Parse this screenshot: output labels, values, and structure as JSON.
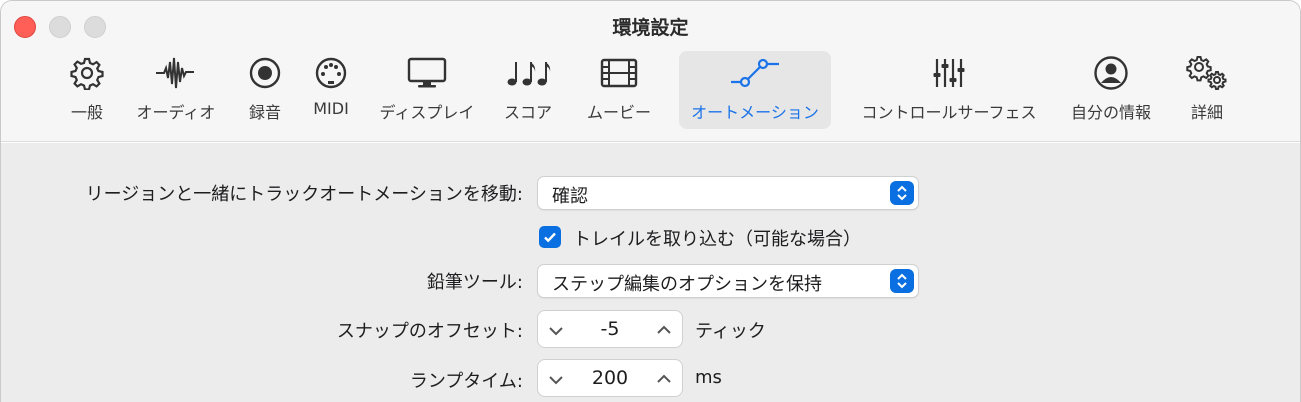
{
  "window": {
    "title": "環境設定"
  },
  "toolbar": {
    "tabs": [
      {
        "label": "一般",
        "icon": "gear-icon"
      },
      {
        "label": "オーディオ",
        "icon": "waveform-icon"
      },
      {
        "label": "録音",
        "icon": "record-icon"
      },
      {
        "label": "MIDI",
        "icon": "midi-connector-icon"
      },
      {
        "label": "ディスプレイ",
        "icon": "display-icon"
      },
      {
        "label": "スコア",
        "icon": "music-notes-icon"
      },
      {
        "label": "ムービー",
        "icon": "film-icon"
      },
      {
        "label": "オートメーション",
        "icon": "automation-curve-icon",
        "selected": true
      },
      {
        "label": "コントロールサーフェス",
        "icon": "faders-icon"
      },
      {
        "label": "自分の情報",
        "icon": "person-icon"
      },
      {
        "label": "詳細",
        "icon": "gears-icon"
      }
    ]
  },
  "settings": {
    "move_automation": {
      "label": "リージョンと一緒にトラックオートメーションを移動:",
      "value": "確認"
    },
    "include_trail": {
      "label": "トレイルを取り込む（可能な場合）",
      "checked": true
    },
    "pencil_tool": {
      "label": "鉛筆ツール:",
      "value": "ステップ編集のオプションを保持"
    },
    "snap_offset": {
      "label": "スナップのオフセット:",
      "value": "-5",
      "unit": "ティック"
    },
    "ramp_time": {
      "label": "ランプタイム:",
      "value": "200",
      "unit": "ms"
    }
  },
  "colors": {
    "accent": "#0a6fe0",
    "close": "#ff5f57",
    "selected_label": "#1a73e8"
  }
}
